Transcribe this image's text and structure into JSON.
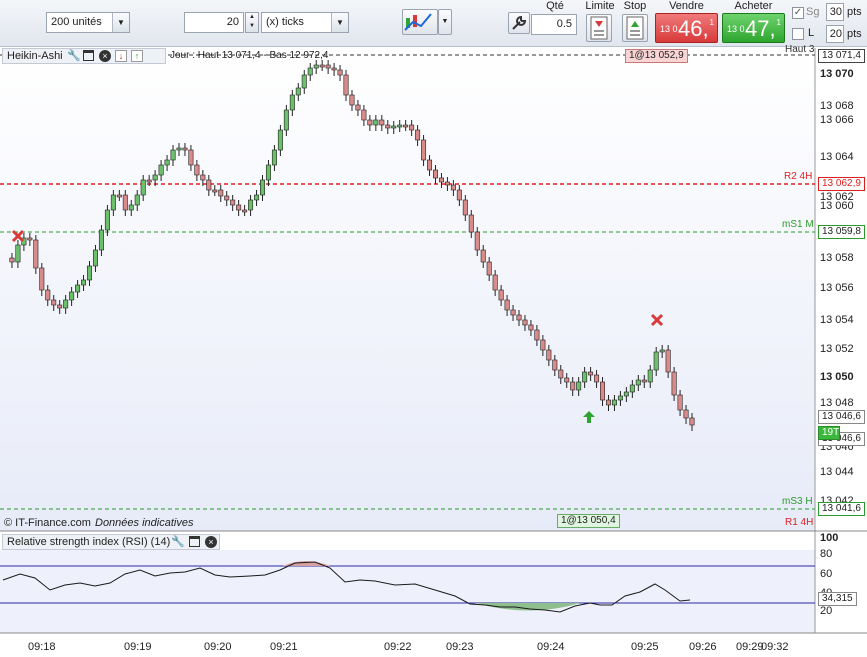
{
  "toolbar": {
    "quantity_select": "200 unités",
    "ticks_value": "20",
    "ticks_select": "(x) ticks",
    "qty_label": "Qté",
    "qty_value": "0.5",
    "limit_label": "Limite",
    "stop_label": "Stop",
    "sell_label": "Vendre",
    "sell_small": "13 0",
    "sell_big": "46,",
    "sell_sup": "1",
    "buy_label": "Acheter",
    "buy_small": "13 0",
    "buy_big": "47,",
    "buy_sup": "1",
    "sg_label": "Sg",
    "l_label": "L",
    "sg_value": "30",
    "l_value": "20",
    "pts1": "pts",
    "pts2": "pts"
  },
  "legend": {
    "indicator": "Heikin-Ashi",
    "info": "Jour : Haut 13 071,4 - Bas 12 972,4",
    "top_tag": "1@13 052,9",
    "bottom_tag": "1@13 050,4",
    "copyright": "© IT-Finance.com",
    "disclaimer": "Données indicatives",
    "rsi_title": "Relative strength index (RSI) (14)"
  },
  "levels": {
    "haut": "Haut 3",
    "r2": "R2 4H",
    "ms1": "mS1 M",
    "ms3": "mS3 H",
    "r1": "R1 4H"
  },
  "price_axis": {
    "ticks": [
      "13 070",
      "13 068",
      "13 066",
      "13 064",
      "13 062",
      "13 060",
      "13 058",
      "13 056",
      "13 054",
      "13 052",
      "13 050",
      "13 048",
      "13 046",
      "13 044",
      "13 042"
    ],
    "tag_top": "13 071,4",
    "tag_r2": "13 062,9",
    "tag_ms1": "13 059,8",
    "tag_a": "13 046,6",
    "tag_b": "13 046,6",
    "tag_ms3": "13 041,6",
    "tag_19t": "19T"
  },
  "rsi_axis": {
    "ticks": [
      "100",
      "80",
      "60",
      "40",
      "20"
    ],
    "value": "34,315"
  },
  "time_axis": [
    "09:18",
    "09:19",
    "09:20",
    "09:21",
    "09:22",
    "09:23",
    "09:24",
    "09:25",
    "09:26",
    "09:29",
    "09:32"
  ],
  "colors": {
    "bull": "#6cc06c",
    "bear": "#d98a8a",
    "r2_line": "#e02020",
    "support_line": "#2a9a2a",
    "rsi_line": "#1a1a1a",
    "rsi_band": "#2a2aa0"
  }
}
